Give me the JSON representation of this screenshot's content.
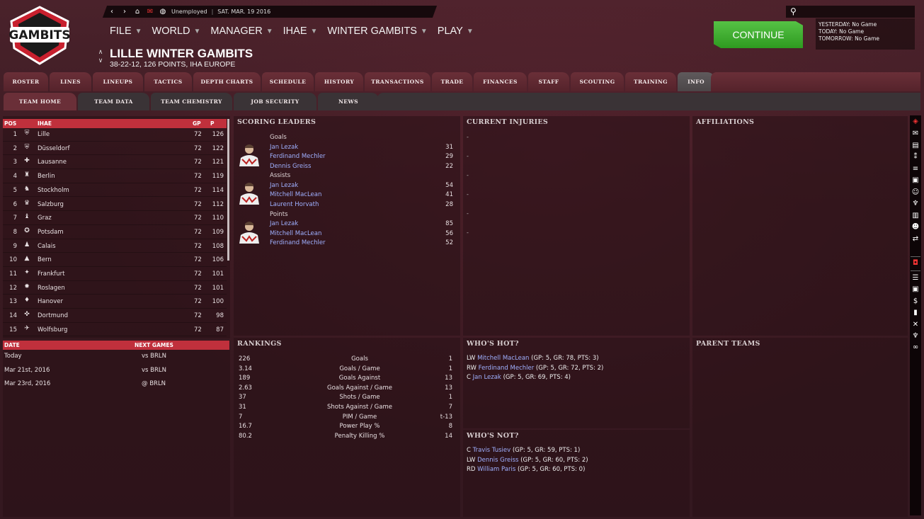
{
  "header": {
    "logo_text": "GAMBITS",
    "nav_status": "Unemployed",
    "nav_date": "SAT. MAR. 19 2016",
    "menus": [
      {
        "label": "FILE"
      },
      {
        "label": "WORLD"
      },
      {
        "label": "MANAGER"
      },
      {
        "label": "IHAE"
      },
      {
        "label": "WINTER GAMBITS"
      },
      {
        "label": "PLAY"
      }
    ],
    "team_name": "LILLE WINTER GAMBITS",
    "team_record": "38-22-12, 126 POINTS, IHA EUROPE",
    "continue_label": "CONTINUE",
    "schedule": {
      "yesterday": "YESTERDAY: No Game",
      "today": "TODAY: No Game",
      "tomorrow": "TOMORROW: No Game"
    }
  },
  "tabs": [
    {
      "label": "ROSTER"
    },
    {
      "label": "LINES"
    },
    {
      "label": "LINEUPS"
    },
    {
      "label": "TACTICS"
    },
    {
      "label": "DEPTH CHARTS"
    },
    {
      "label": "SCHEDULE"
    },
    {
      "label": "HISTORY"
    },
    {
      "label": "TRANSACTIONS"
    },
    {
      "label": "TRADE"
    },
    {
      "label": "FINANCES"
    },
    {
      "label": "STAFF"
    },
    {
      "label": "SCOUTING"
    },
    {
      "label": "TRAINING"
    },
    {
      "label": "INFO"
    }
  ],
  "subtabs": [
    {
      "label": "TEAM HOME"
    },
    {
      "label": "TEAM DATA"
    },
    {
      "label": "TEAM CHEMISTRY"
    },
    {
      "label": "JOB SECURITY"
    },
    {
      "label": "NEWS"
    }
  ],
  "standings": {
    "headers": {
      "pos": "POS",
      "league": "IHAE",
      "gp": "GP",
      "p": "P"
    },
    "rows": [
      {
        "pos": "1",
        "team": "Lille",
        "gp": "72",
        "p": "126"
      },
      {
        "pos": "2",
        "team": "Düsseldorf",
        "gp": "72",
        "p": "122"
      },
      {
        "pos": "3",
        "team": "Lausanne",
        "gp": "72",
        "p": "121"
      },
      {
        "pos": "4",
        "team": "Berlin",
        "gp": "72",
        "p": "119"
      },
      {
        "pos": "5",
        "team": "Stockholm",
        "gp": "72",
        "p": "114"
      },
      {
        "pos": "6",
        "team": "Salzburg",
        "gp": "72",
        "p": "112"
      },
      {
        "pos": "7",
        "team": "Graz",
        "gp": "72",
        "p": "110"
      },
      {
        "pos": "8",
        "team": "Potsdam",
        "gp": "72",
        "p": "109"
      },
      {
        "pos": "9",
        "team": "Calais",
        "gp": "72",
        "p": "108"
      },
      {
        "pos": "10",
        "team": "Bern",
        "gp": "72",
        "p": "106"
      },
      {
        "pos": "11",
        "team": "Frankfurt",
        "gp": "72",
        "p": "101"
      },
      {
        "pos": "12",
        "team": "Roslagen",
        "gp": "72",
        "p": "101"
      },
      {
        "pos": "13",
        "team": "Hanover",
        "gp": "72",
        "p": "100"
      },
      {
        "pos": "14",
        "team": "Dortmund",
        "gp": "72",
        "p": "98"
      },
      {
        "pos": "15",
        "team": "Wolfsburg",
        "gp": "72",
        "p": "87"
      }
    ]
  },
  "games": {
    "headers": {
      "date": "DATE",
      "next": "NEXT GAMES"
    },
    "rows": [
      {
        "date": "Today",
        "opp": "vs BRLN"
      },
      {
        "date": "Mar 21st, 2016",
        "opp": "vs BRLN"
      },
      {
        "date": "Mar 23rd, 2016",
        "opp": "@ BRLN"
      }
    ]
  },
  "scoring_leaders": {
    "title": "SCORING LEADERS",
    "categories": [
      {
        "label": "Goals",
        "players": [
          {
            "name": "Jan Lezak",
            "value": "31"
          },
          {
            "name": "Ferdinand Mechler",
            "value": "29"
          },
          {
            "name": "Dennis Greiss",
            "value": "22"
          }
        ]
      },
      {
        "label": "Assists",
        "players": [
          {
            "name": "Jan Lezak",
            "value": "54"
          },
          {
            "name": "Mitchell MacLean",
            "value": "41"
          },
          {
            "name": "Laurent Horvath",
            "value": "28"
          }
        ]
      },
      {
        "label": "Points",
        "players": [
          {
            "name": "Jan Lezak",
            "value": "85"
          },
          {
            "name": "Mitchell MacLean",
            "value": "56"
          },
          {
            "name": "Ferdinand Mechler",
            "value": "52"
          }
        ]
      }
    ]
  },
  "injuries": {
    "title": "CURRENT INJURIES",
    "rows": [
      "-",
      "-",
      "-",
      "-",
      "-",
      "-",
      "-",
      "-"
    ]
  },
  "affiliations": {
    "title": "AFFILIATIONS"
  },
  "parent_teams": {
    "title": "PARENT TEAMS"
  },
  "rankings": {
    "title": "RANKINGS",
    "rows": [
      {
        "value": "226",
        "label": "Goals",
        "rank": "1"
      },
      {
        "value": "3.14",
        "label": "Goals / Game",
        "rank": "1"
      },
      {
        "value": "189",
        "label": "Goals Against",
        "rank": "13"
      },
      {
        "value": "2.63",
        "label": "Goals Against / Game",
        "rank": "13"
      },
      {
        "value": "37",
        "label": "Shots / Game",
        "rank": "1"
      },
      {
        "value": "31",
        "label": "Shots Against / Game",
        "rank": "7"
      },
      {
        "value": "7",
        "label": "PIM / Game",
        "rank": "t-13"
      },
      {
        "value": "16.7",
        "label": "Power Play %",
        "rank": "8"
      },
      {
        "value": "80.2",
        "label": "Penalty Killing %",
        "rank": "14"
      }
    ]
  },
  "whos_hot": {
    "title": "WHO'S HOT?",
    "rows": [
      {
        "pos": "LW",
        "name": "Mitchell MacLean",
        "stats": "(GP: 5, GR: 78, PTS: 3)"
      },
      {
        "pos": "RW",
        "name": "Ferdinand Mechler",
        "stats": "(GP: 5, GR: 72, PTS: 2)"
      },
      {
        "pos": "C",
        "name": "Jan Lezak",
        "stats": "(GP: 5, GR: 69, PTS: 4)"
      }
    ]
  },
  "whos_not": {
    "title": "WHO'S NOT?",
    "rows": [
      {
        "pos": "C",
        "name": "Travis Tusiev",
        "stats": "(GP: 5, GR: 59, PTS: 1)"
      },
      {
        "pos": "LW",
        "name": "Dennis Greiss",
        "stats": "(GP: 5, GR: 60, PTS: 2)"
      },
      {
        "pos": "RD",
        "name": "William Paris",
        "stats": "(GP: 5, GR: 60, PTS: 0)"
      }
    ]
  },
  "colors": {
    "accent_red": "#c0303c",
    "link": "#9fb0ff",
    "continue_green": "#3aa82a"
  }
}
